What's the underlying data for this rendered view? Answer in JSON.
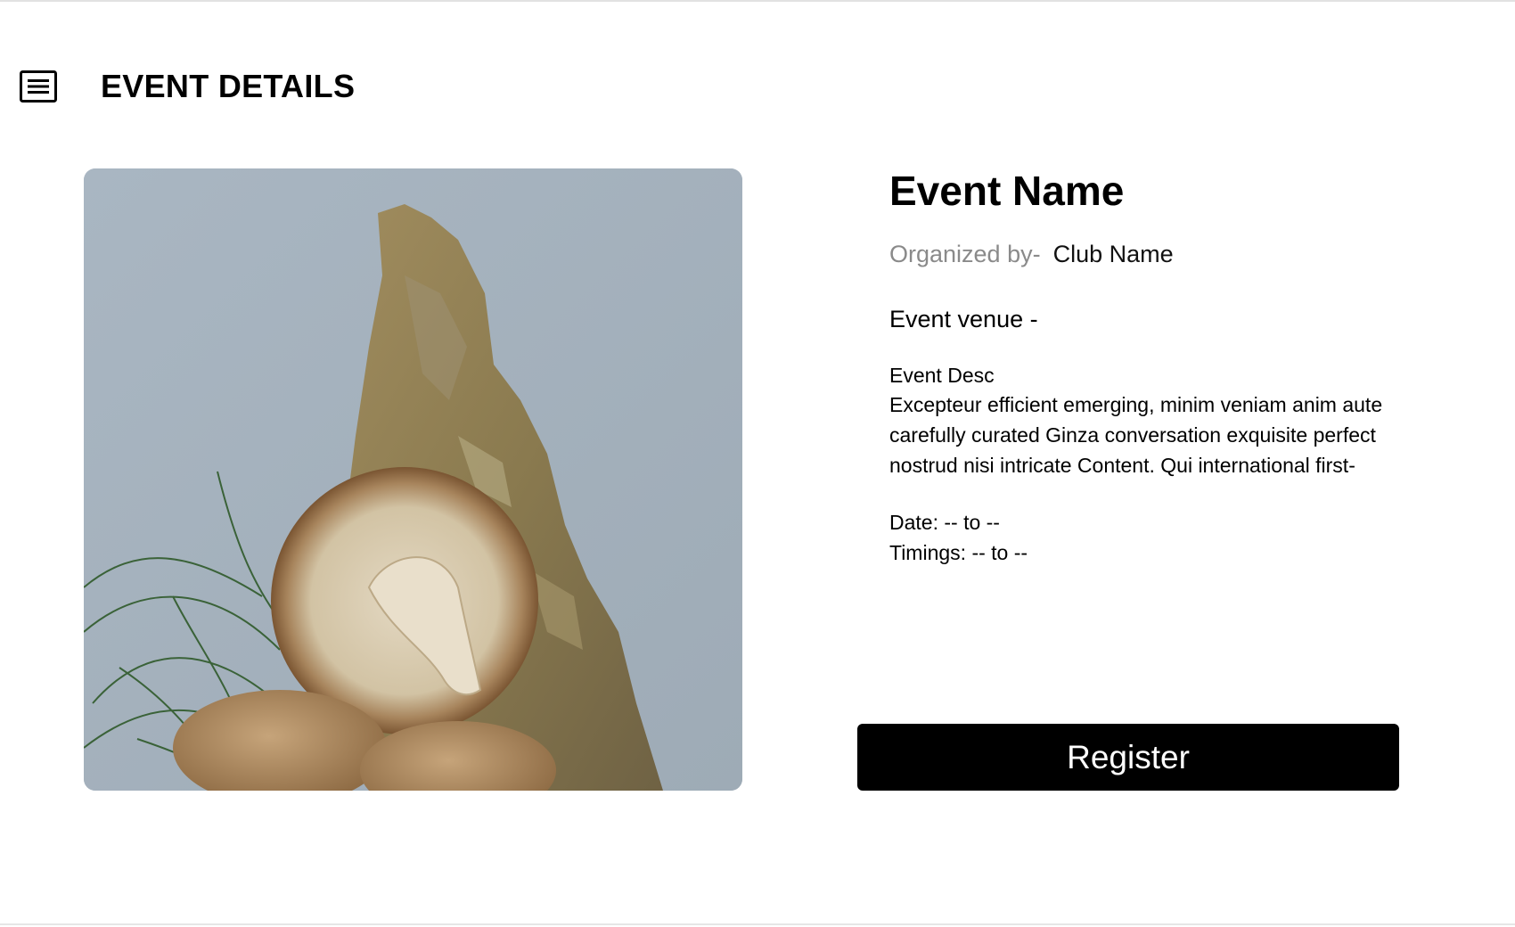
{
  "header": {
    "title": "EVENT DETAILS",
    "menu_icon": "menu-icon"
  },
  "image": {
    "description_icon": "mushroom-photo"
  },
  "event": {
    "name": "Event Name",
    "organized_label": "Organized by-",
    "club_name": "Club Name",
    "venue": "Event venue -",
    "desc_title": "Event Desc",
    "desc_body": "Excepteur efficient emerging, minim veniam anim aute carefully curated Ginza conversation exquisite perfect nostrud nisi intricate Content. Qui  international first-",
    "date": "Date: -- to --",
    "timings": "Timings: -- to --"
  },
  "actions": {
    "register_label": "Register"
  },
  "colors": {
    "background": "#ffffff",
    "text": "#000000",
    "muted": "#8a8a8a",
    "button": "#000000",
    "button_text": "#ffffff"
  }
}
